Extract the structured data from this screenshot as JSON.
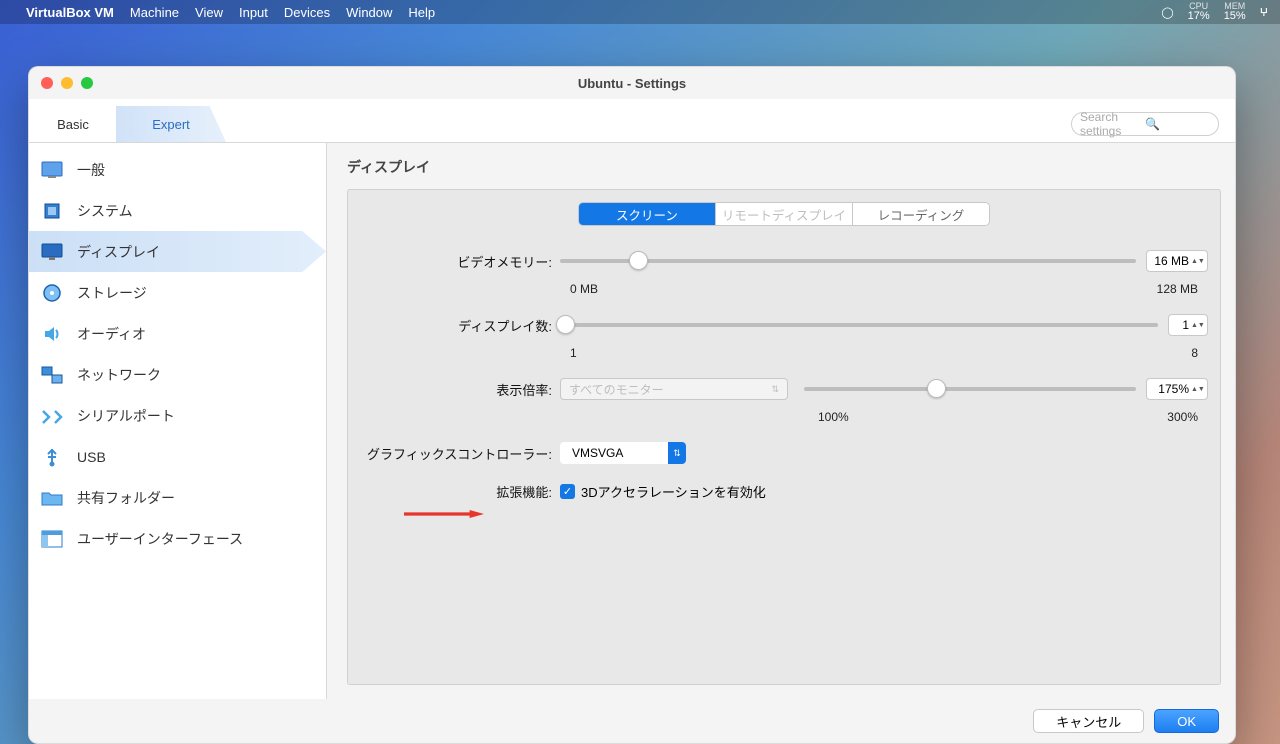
{
  "menubar": {
    "app": "VirtualBox VM",
    "items": [
      "Machine",
      "View",
      "Input",
      "Devices",
      "Window",
      "Help"
    ],
    "cpu_lbl": "CPU",
    "cpu": "17%",
    "mem_lbl": "MEM",
    "mem": "15%"
  },
  "window": {
    "title": "Ubuntu - Settings"
  },
  "tabs": {
    "basic": "Basic",
    "expert": "Expert"
  },
  "search": {
    "placeholder": "Search settings"
  },
  "sidebar": {
    "items": [
      {
        "label": "一般"
      },
      {
        "label": "システム"
      },
      {
        "label": "ディスプレイ"
      },
      {
        "label": "ストレージ"
      },
      {
        "label": "オーディオ"
      },
      {
        "label": "ネットワーク"
      },
      {
        "label": "シリアルポート"
      },
      {
        "label": "USB"
      },
      {
        "label": "共有フォルダー"
      },
      {
        "label": "ユーザーインターフェース"
      }
    ]
  },
  "panel": {
    "heading": "ディスプレイ",
    "seg": {
      "screen": "スクリーン",
      "remote": "リモートディスプレイ",
      "recording": "レコーディング"
    },
    "vmem": {
      "label": "ビデオメモリー:",
      "value": "16 MB",
      "min": "0 MB",
      "max": "128 MB"
    },
    "disp": {
      "label": "ディスプレイ数:",
      "value": "1",
      "min": "1",
      "max": "8"
    },
    "scale": {
      "label": "表示倍率:",
      "monitor": "すべてのモニター",
      "value": "175%",
      "min": "100%",
      "max": "300%"
    },
    "gctrl": {
      "label": "グラフィックスコントローラー:",
      "value": "VMSVGA"
    },
    "ext": {
      "label": "拡張機能:",
      "chk": "3Dアクセラレーションを有効化"
    }
  },
  "footer": {
    "cancel": "キャンセル",
    "ok": "OK"
  }
}
